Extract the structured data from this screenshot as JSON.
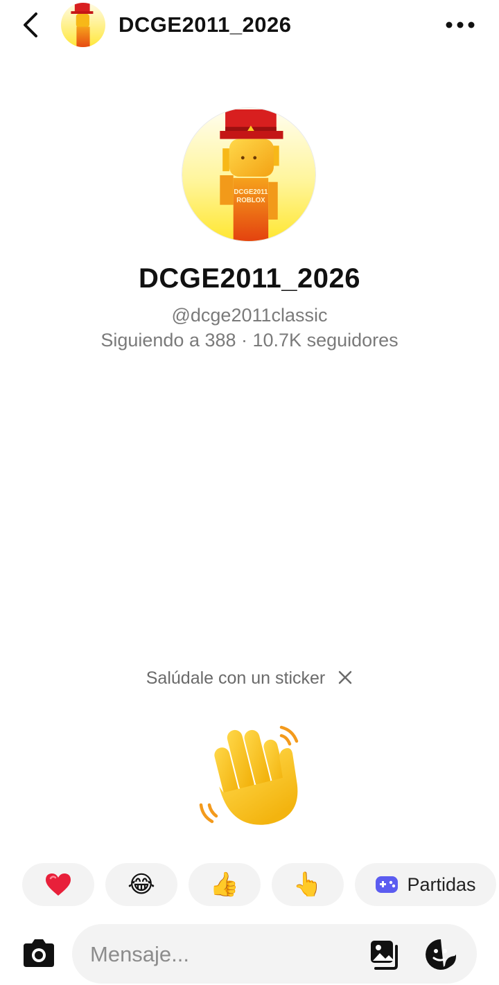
{
  "header": {
    "title": "DCGE2011_2026",
    "back_icon": "chevron-left-icon",
    "more_icon": "more-horizontal-icon"
  },
  "profile": {
    "name": "DCGE2011_2026",
    "handle": "@dcge2011classic",
    "stats": "Siguiendo a 388 · 10.7K seguidores",
    "avatar_badge_line1": "DCGE2011",
    "avatar_badge_line2": "ROBLOX"
  },
  "greeting": {
    "text": "Salúdale con un sticker",
    "close_icon": "close-icon",
    "sticker_icon": "waving-hand-icon"
  },
  "quick_replies": [
    {
      "emoji": "❤️",
      "icon": "heart-icon"
    },
    {
      "emoji": "😂",
      "icon": "tears-of-joy-icon"
    },
    {
      "emoji": "👍",
      "icon": "thumbs-up-icon"
    },
    {
      "emoji": "👆",
      "icon": "pointing-finger-icon"
    },
    {
      "label": "Partidas",
      "icon": "gamepad-icon"
    }
  ],
  "composer": {
    "placeholder": "Mensaje...",
    "camera_icon": "camera-icon",
    "gallery_icon": "gallery-icon",
    "sticker_icon": "sticker-icon"
  },
  "colors": {
    "text_primary": "#111111",
    "text_secondary": "#7a7a7a",
    "chip_bg": "#f3f3f3",
    "gamepad_accent": "#5b5cf0",
    "heart": "#e8203a",
    "hand_yellow": "#f7c22e"
  }
}
